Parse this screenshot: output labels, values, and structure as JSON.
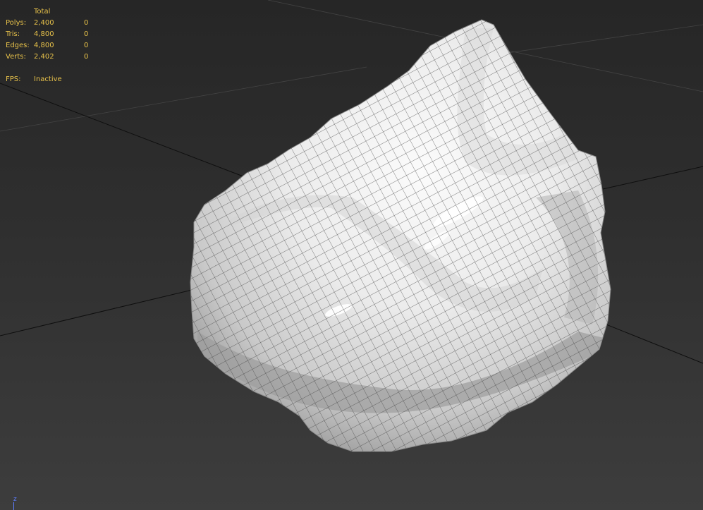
{
  "viewport": {
    "stats": {
      "column_header": "Total",
      "rows": [
        {
          "label": "Polys:",
          "total": "2,400",
          "selected": "0"
        },
        {
          "label": "Tris:",
          "total": "4,800",
          "selected": "0"
        },
        {
          "label": "Edges:",
          "total": "4,800",
          "selected": "0"
        },
        {
          "label": "Verts:",
          "total": "2,402",
          "selected": "0"
        }
      ],
      "fps_label": "FPS:",
      "fps_value": "Inactive"
    },
    "axis_gizmo": {
      "z_label": "z"
    },
    "colors": {
      "stats_text": "#e8c24a",
      "background_top": "#262626",
      "background_bottom": "#3d3d3d",
      "mesh_surface": "#e6e6e6",
      "wireframe": "#4a4a4a",
      "grid_line": "#111111",
      "z_axis": "#5c7cff"
    },
    "object": {
      "type": "rock mesh with wireframe overlay"
    }
  }
}
